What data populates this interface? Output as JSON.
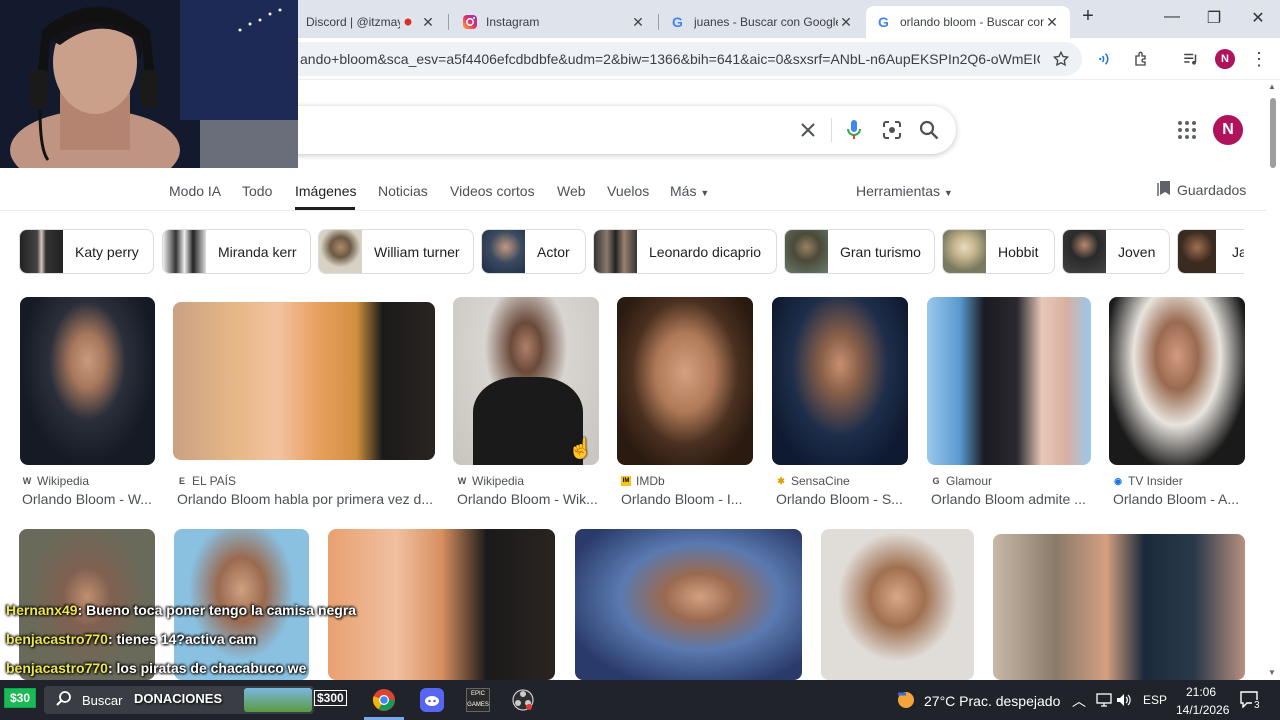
{
  "browser": {
    "tabs": [
      {
        "title": "Discord | @itzmay",
        "favicon": "discord-icon"
      },
      {
        "title": "Instagram",
        "favicon": "instagram-icon"
      },
      {
        "title": "juanes - Buscar con Google",
        "favicon": "google-icon"
      },
      {
        "title": "orlando bloom - Buscar con",
        "favicon": "google-icon",
        "active": true
      }
    ],
    "url": "ando+bloom&sca_esv=a5f4406efcdbdbfe&udm=2&biw=1366&bih=641&aic=0&sxsrf=ANbL-n6AupEKSPIn2Q6-oWmEICT-Zy...",
    "profile_initial": "N"
  },
  "search": {
    "query": "",
    "profile_initial": "N"
  },
  "nav": {
    "tabs": [
      "Modo IA",
      "Todo",
      "Imágenes",
      "Noticias",
      "Videos cortos",
      "Web",
      "Vuelos",
      "Más"
    ],
    "active": "Imágenes",
    "tools": "Herramientas",
    "saved": "Guardados"
  },
  "chips": [
    "Katy perry",
    "Miranda kerr",
    "William turner",
    "Actor",
    "Leonardo dicaprio",
    "Gran turismo",
    "Hobbit",
    "Joven",
    "Ja"
  ],
  "results": [
    {
      "source": "Wikipedia",
      "title": "Orlando Bloom - W..."
    },
    {
      "source": "EL PAÍS",
      "title": "Orlando Bloom habla por primera vez d..."
    },
    {
      "source": "Wikipedia",
      "title": "Orlando Bloom - Wik..."
    },
    {
      "source": "IMDb",
      "title": "Orlando Bloom - I..."
    },
    {
      "source": "SensaCine",
      "title": "Orlando Bloom - S..."
    },
    {
      "source": "Glamour",
      "title": "Orlando Bloom admite ..."
    },
    {
      "source": "TV Insider",
      "title": "Orlando Bloom - A..."
    }
  ],
  "chat": [
    {
      "user": "Hernanx49",
      "msg": ": Bueno toca poner tengo la camisa negra"
    },
    {
      "user": "benjacastro770",
      "msg": ": tienes 14?activa cam"
    },
    {
      "user": "benjacastro770",
      "msg": ": los piratas de chacabuco we"
    }
  ],
  "taskbar": {
    "badge_left": "$30",
    "search_label": "Buscar",
    "donations_label": "DONACIONES",
    "badge_right": "$300",
    "weather": "27°C  Prac. despejado",
    "language": "ESP",
    "time": "21:06",
    "date": "14/1/2026",
    "notifications": "3"
  }
}
